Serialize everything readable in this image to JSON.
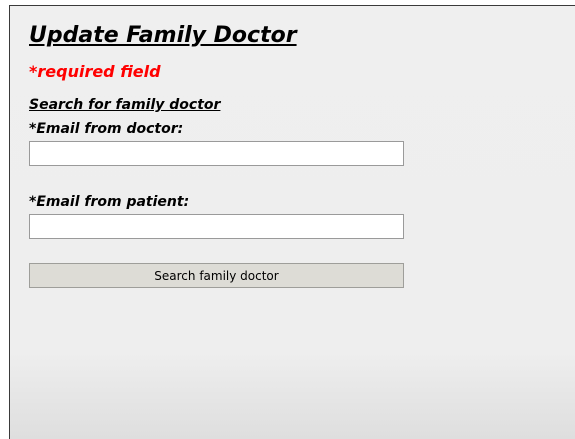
{
  "form": {
    "title": "Update Family Doctor",
    "required_note": "*required field",
    "section_heading": "Search for family doctor",
    "doctor_email": {
      "label": "*Email from doctor:",
      "value": "",
      "placeholder": ""
    },
    "patient_email": {
      "label": "*Email from patient:",
      "value": "",
      "placeholder": ""
    },
    "search_button_label": "Search family doctor"
  },
  "colors": {
    "required_text": "#ff0000",
    "button_background": "#dddcd6",
    "panel_background": "#eeeeee"
  }
}
